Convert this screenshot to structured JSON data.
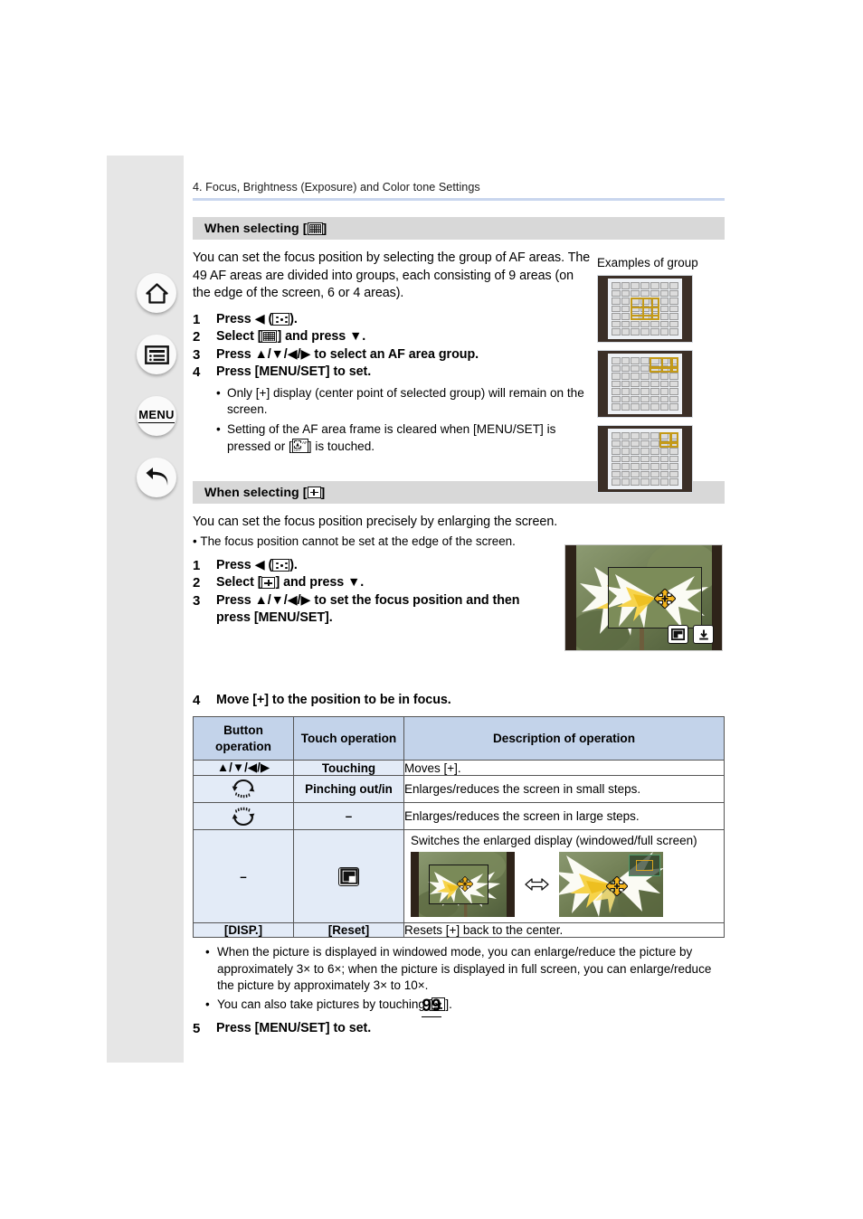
{
  "sidebar": {
    "items": [
      {
        "name": "home-icon",
        "label": "Home"
      },
      {
        "name": "contents-icon",
        "label": "Contents"
      },
      {
        "name": "menu-button",
        "label": "MENU"
      },
      {
        "name": "back-icon",
        "label": "Back"
      }
    ]
  },
  "chapter": "4. Focus, Brightness (Exposure) and Color tone Settings",
  "section1": {
    "heading_prefix": "When selecting [",
    "heading_suffix": "]",
    "heading_icon": "af-area-grid-icon",
    "intro": "You can set the focus position by selecting the group of AF areas. The 49 AF areas are divided into groups, each consisting of 9 areas (on the edge of the screen, 6 or 4 areas).",
    "steps": [
      {
        "num": "1",
        "pre": "Press ◀ (",
        "post": ")."
      },
      {
        "num": "2",
        "pre": "Select [",
        "post": "] and press ▼."
      },
      {
        "num": "3",
        "text": "Press ▲/▼/◀/▶ to select an AF area group."
      },
      {
        "num": "4",
        "text": "Press [MENU/SET] to set."
      }
    ],
    "bullets": [
      "Only [+] display (center point of selected group) will remain on the screen.",
      {
        "pre": "Setting of the AF area frame is cleared when [MENU/SET] is pressed or [",
        "post": "] is touched."
      }
    ],
    "examples_caption": "Examples of group"
  },
  "section2": {
    "heading_prefix": "When selecting [",
    "heading_suffix": "]",
    "heading_icon": "pinpoint-plus-icon",
    "intro": "You can set the focus position precisely by enlarging the screen.",
    "note": "The focus position cannot be set at the edge of the screen.",
    "steps": [
      {
        "num": "1",
        "pre": "Press ◀ (",
        "post": ")."
      },
      {
        "num": "2",
        "pre": "Select [",
        "post": "] and press ▼."
      },
      {
        "num": "3",
        "text": "Press ▲/▼/◀/▶ to set the focus position and then press [MENU/SET]."
      },
      {
        "num": "4",
        "text": "Move [+] to the position to be in focus."
      },
      {
        "num": "5",
        "text": "Press [MENU/SET] to set."
      }
    ]
  },
  "table": {
    "headers": [
      "Button operation",
      "Touch operation",
      "Description of operation"
    ],
    "rows": [
      {
        "button": "▲/▼/◀/▶",
        "touch": "Touching",
        "desc": "Moves [+]."
      },
      {
        "button_icon": "rear-dial-icon",
        "touch": "Pinching out/in",
        "desc": "Enlarges/reduces the screen in small steps."
      },
      {
        "button_icon": "front-dial-icon",
        "touch": "–",
        "desc": "Enlarges/reduces the screen in large steps."
      },
      {
        "button": "–",
        "touch_icon": "windowed-display-icon",
        "desc": "Switches the enlarged display (windowed/full screen)"
      },
      {
        "button": "[DISP.]",
        "touch": "[Reset]",
        "desc": "Resets [+] back to the center."
      }
    ]
  },
  "notes": [
    "When the picture is displayed in windowed mode, you can enlarge/reduce the picture by approximately 3× to 6×; when the picture is displayed in full screen, you can enlarge/reduce the picture by approximately 3× to 10×.",
    {
      "pre": "You can also take pictures by touching [",
      "post": "]."
    }
  ],
  "page_number": "99",
  "colors": {
    "section_header_bg": "#d8d8d8",
    "rule": "#c9d6ee",
    "table_header_bg": "#c3d3ea",
    "table_cell_bg": "#e3ebf7",
    "sidebar_band": "#e6e6e6",
    "af_highlight": "#c49a18"
  }
}
